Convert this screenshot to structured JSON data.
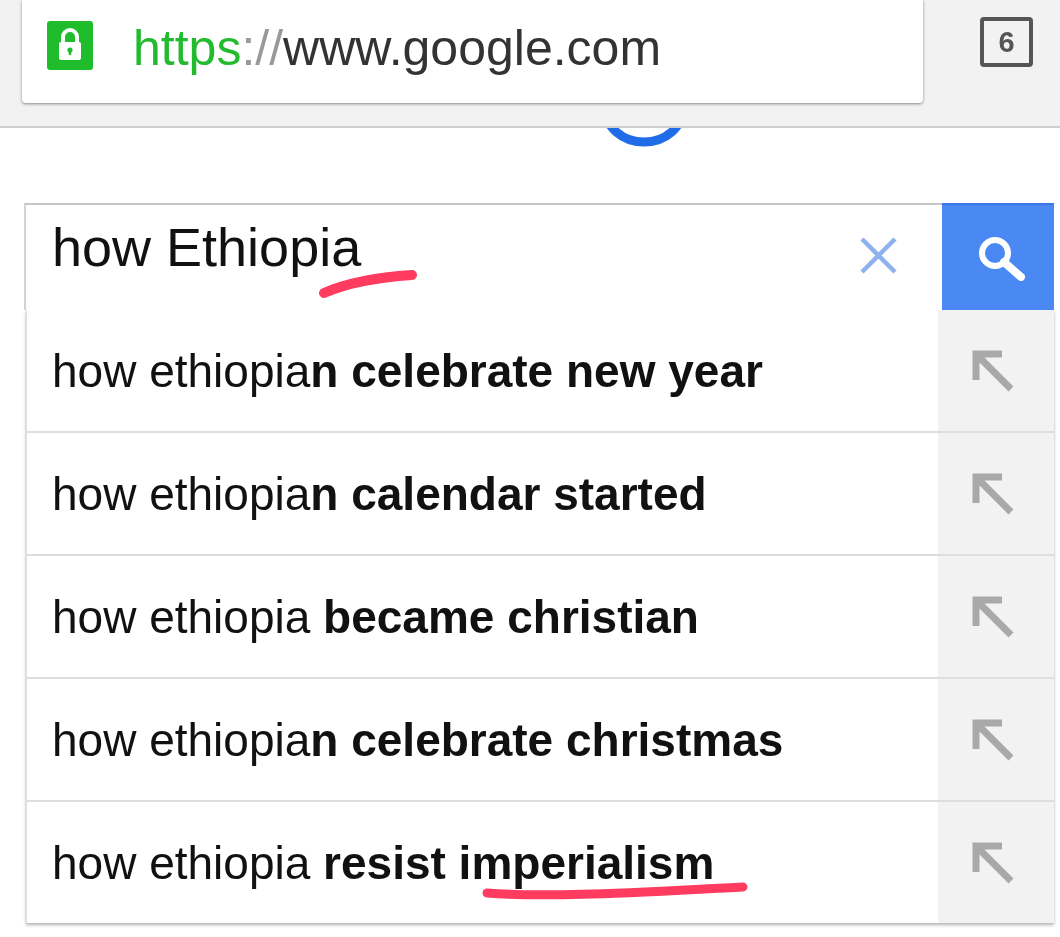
{
  "toolbar": {
    "address": {
      "secure": true,
      "scheme": "https",
      "separator": "://",
      "host": "www.google.com"
    },
    "tab_count": "6"
  },
  "search": {
    "value": "how Ethiopia",
    "underlined": true
  },
  "suggestions": [
    {
      "text": "how ethiopia**n celebrate new year**",
      "underlined": false
    },
    {
      "text": "how ethiopia**n calendar started**",
      "underlined": false
    },
    {
      "text": "how ethiopia **became christian**",
      "underlined": false
    },
    {
      "text": "how ethiopia**n celebrate christmas**",
      "underlined": false
    },
    {
      "text": "how ethiopia **resist imperialism**",
      "underlined": true
    }
  ]
}
